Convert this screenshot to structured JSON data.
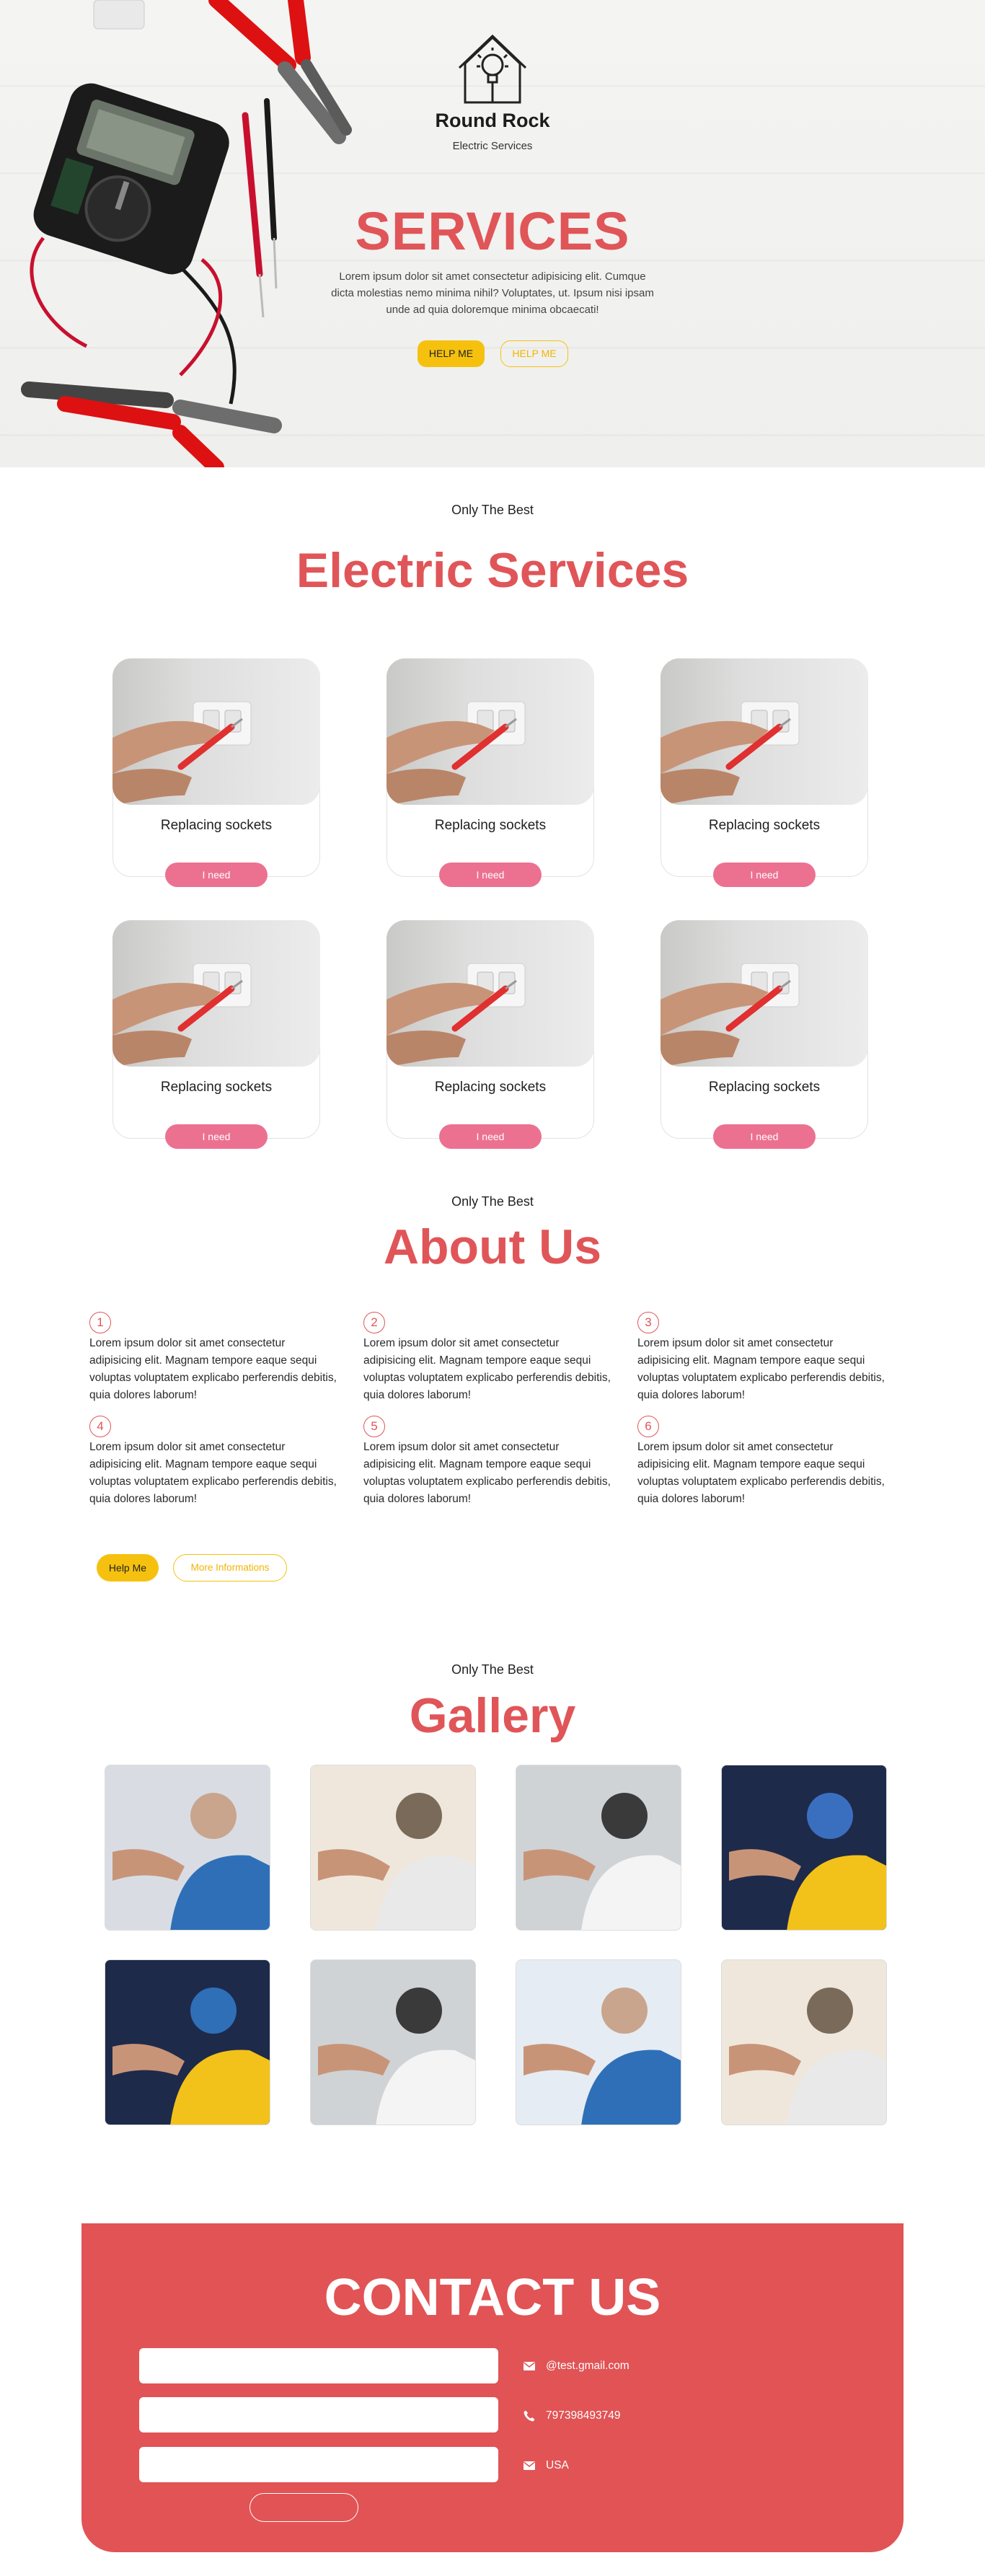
{
  "hero": {
    "brand_name": "Round Rock",
    "brand_sub": "Electric Services",
    "title": "SERVICES",
    "text": "Lorem ipsum dolor sit amet consectetur adipisicing elit. Cumque dicta molestias nemo minima nihil? Voluptates, ut. Ipsum nisi ipsam unde ad quia doloremque minima obcaecati!",
    "btn_primary": "HELP ME",
    "btn_secondary": "HELP ME"
  },
  "services": {
    "kicker": "Only The Best",
    "title": "Electric Services",
    "cards": [
      {
        "title": "Replacing sockets",
        "button": "I need"
      },
      {
        "title": "Replacing sockets",
        "button": "I need"
      },
      {
        "title": "Replacing sockets",
        "button": "I need"
      },
      {
        "title": "Replacing sockets",
        "button": "I need"
      },
      {
        "title": "Replacing sockets",
        "button": "I need"
      },
      {
        "title": "Replacing sockets",
        "button": "I need"
      }
    ]
  },
  "about": {
    "kicker": "Only The Best",
    "title": "About Us",
    "items": [
      {
        "num": "1",
        "text": "Lorem ipsum dolor sit amet consectetur adipisicing elit. Magnam tempore eaque sequi voluptas voluptatem explicabo perferendis debitis, quia dolores laborum!"
      },
      {
        "num": "2",
        "text": "Lorem ipsum dolor sit amet consectetur adipisicing elit. Magnam tempore eaque sequi voluptas voluptatem explicabo perferendis debitis, quia dolores laborum!"
      },
      {
        "num": "3",
        "text": "Lorem ipsum dolor sit amet consectetur adipisicing elit. Magnam tempore eaque sequi voluptas voluptatem explicabo perferendis debitis, quia dolores laborum!"
      },
      {
        "num": "4",
        "text": "Lorem ipsum dolor sit amet consectetur adipisicing elit. Magnam tempore eaque sequi voluptas voluptatem explicabo perferendis debitis, quia dolores laborum!"
      },
      {
        "num": "5",
        "text": "Lorem ipsum dolor sit amet consectetur adipisicing elit. Magnam tempore eaque sequi voluptas voluptatem explicabo perferendis debitis, quia dolores laborum!"
      },
      {
        "num": "6",
        "text": "Lorem ipsum dolor sit amet consectetur adipisicing elit. Magnam tempore eaque sequi voluptas voluptatem explicabo perferendis debitis, quia dolores laborum!"
      }
    ],
    "btn_primary": "Help Me",
    "btn_secondary": "More Informations"
  },
  "gallery": {
    "kicker": "Only The Best",
    "title": "Gallery"
  },
  "contact": {
    "title": "CONTACT US",
    "email": "@test.gmail.com",
    "phone": "797398493749",
    "location": "USA"
  },
  "colors": {
    "accent_red": "#e05558",
    "button_pink": "#ec7191",
    "button_yellow": "#f6c10e",
    "contact_bg": "#e15355"
  }
}
